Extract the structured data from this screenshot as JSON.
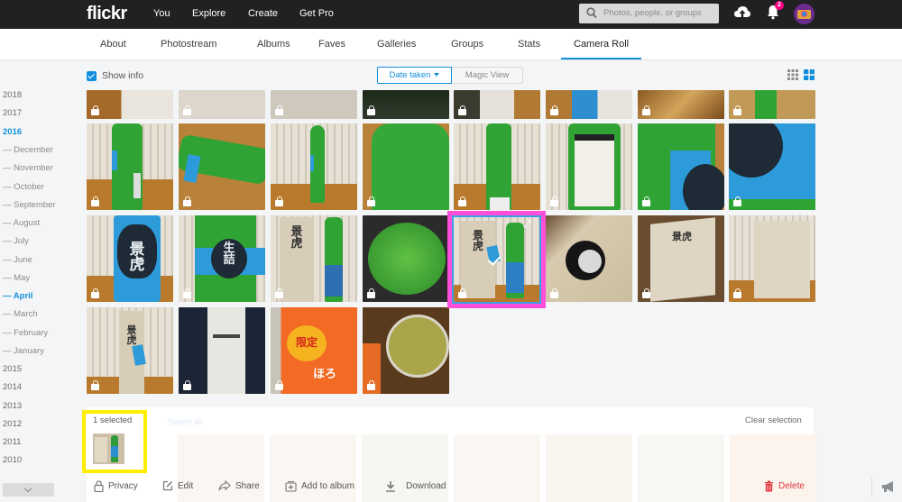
{
  "topbar": {
    "logo": "flickr",
    "nav": [
      "You",
      "Explore",
      "Create",
      "Get Pro"
    ],
    "search_placeholder": "Photos, people, or groups",
    "notifications_count": "2"
  },
  "subnav": {
    "tabs": [
      "About",
      "Photostream",
      "Albums",
      "Faves",
      "Galleries",
      "Groups",
      "Stats",
      "Camera Roll"
    ],
    "active_tab": "Camera Roll"
  },
  "toolbar": {
    "show_info_label": "Show info",
    "show_info_checked": true,
    "sort_selected": "Date taken",
    "magic_view_label": "Magic View",
    "view_modes": [
      "small-grid",
      "large-grid"
    ],
    "active_view": "large-grid"
  },
  "sidebar": {
    "years_before": [
      "2018",
      "2017"
    ],
    "active_year": "2016",
    "months": [
      "December",
      "November",
      "October",
      "September",
      "August",
      "July",
      "June",
      "May",
      "April",
      "March",
      "February",
      "January"
    ],
    "active_month": "April",
    "years_after": [
      "2015",
      "2014",
      "2013",
      "2012",
      "2011",
      "2010"
    ]
  },
  "grid": {
    "rows": [
      {
        "count": 8,
        "partial": true
      },
      {
        "count": 8
      },
      {
        "count": 8,
        "selected_index": 4
      },
      {
        "count": 4
      }
    ],
    "photo_overlay_icon": "lock-icon",
    "selected_photo_icons": [
      "check-icon",
      "expand-icon"
    ]
  },
  "selection": {
    "count_label": "1 selected",
    "select_all_label": "Select all",
    "clear_label": "Clear selection",
    "actions": [
      {
        "label": "Privacy",
        "icon": "lock-icon"
      },
      {
        "label": "Edit",
        "icon": "edit-icon"
      },
      {
        "label": "Share",
        "icon": "share-icon"
      },
      {
        "label": "Add to album",
        "icon": "add-to-album-icon"
      },
      {
        "label": "Download",
        "icon": "download-icon"
      }
    ],
    "delete_label": "Delete"
  },
  "colors": {
    "accent": "#128fdc",
    "topbar": "#212124",
    "badge": "#ff0084",
    "delete": "#e0383e",
    "highlight_selected": "#ff4fd8",
    "highlight_thumb": "#ffee00"
  }
}
